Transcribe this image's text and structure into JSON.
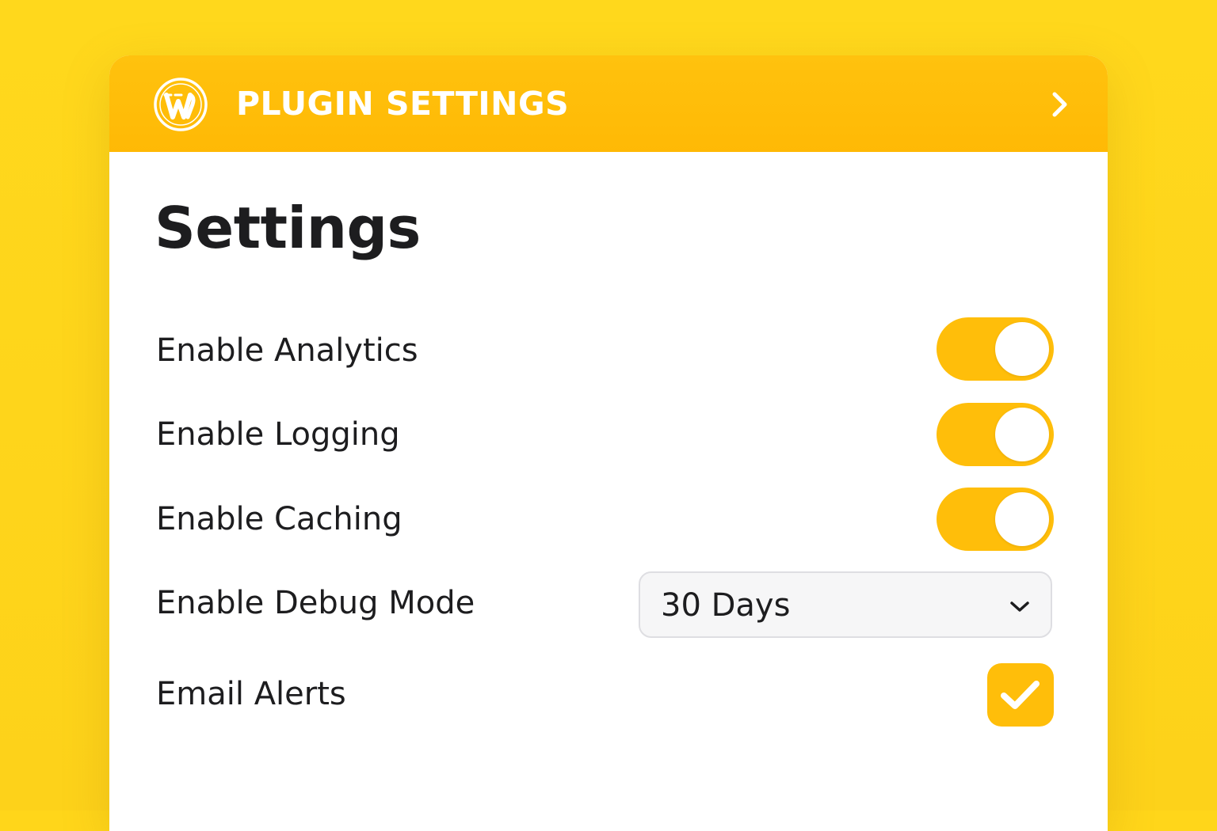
{
  "header": {
    "logo_icon": "wordpress-logo-icon",
    "title": "PLUGIN SETTINGS",
    "nav_icon": "chevron-right-icon"
  },
  "page": {
    "title": "Settings"
  },
  "settings": {
    "analytics": {
      "label": "Enable Analytics",
      "control": "toggle",
      "enabled": true
    },
    "logging": {
      "label": "Enable Logging",
      "control": "toggle",
      "enabled": true
    },
    "caching": {
      "label": "Enable Caching",
      "control": "toggle",
      "enabled": true
    },
    "debug_mode": {
      "label": "Enable Debug Mode",
      "control": "select",
      "selected_value": "30 Days",
      "icon": "chevron-down-icon"
    },
    "email_alerts": {
      "label": "Email Alerts",
      "control": "checkbox",
      "checked": true,
      "icon": "checkmark-icon"
    }
  },
  "colors": {
    "background": "#FFD61A",
    "accent": "#FFBE0A",
    "header": "#FFBC08",
    "panel": "#FFFFFF",
    "text": "#1D1D1F"
  }
}
